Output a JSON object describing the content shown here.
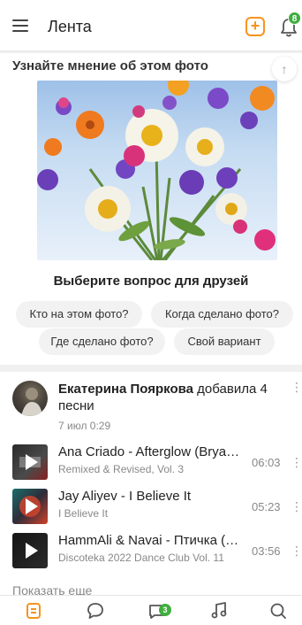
{
  "header": {
    "title": "Лента",
    "notification_count": "8"
  },
  "photo_poll": {
    "title": "Узнайте мнение об этом фото",
    "question": "Выберите вопрос для друзей",
    "options": [
      "Кто на этом фото?",
      "Когда сделано фото?",
      "Где сделано фото?",
      "Свой вариант"
    ]
  },
  "music_post": {
    "author": "Екатерина Пояркова",
    "action": " добавила 4 песни",
    "date": "7 июл 0:29",
    "tracks": [
      {
        "title": "Ana Criado - Afterglow (Bryan Kearney Remix)",
        "album": "Remixed & Revised, Vol. 3",
        "duration": "06:03"
      },
      {
        "title": "Jay Aliyev - I Believe It",
        "album": "I Believe It",
        "duration": "05:23"
      },
      {
        "title": "HammAli & Navai - Птичка (Remix)",
        "album": "Discoteka 2022 Dance Club Vol. 11",
        "duration": "03:56"
      }
    ],
    "show_more": "Показать еще"
  },
  "bottom_nav": {
    "messages_count": "3"
  },
  "colors": {
    "accent": "#f7931e",
    "badge": "#3fae3f"
  }
}
